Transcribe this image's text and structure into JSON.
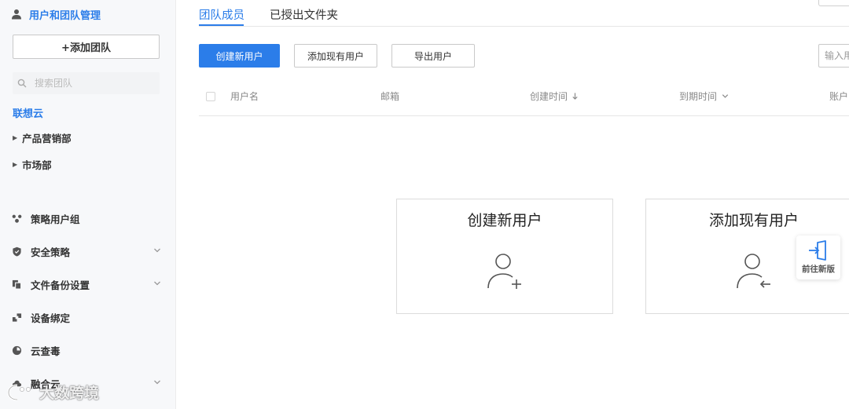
{
  "sidebar": {
    "title": "用户和团队管理",
    "add_team_label": "+添加团队",
    "search_placeholder": "搜索团队",
    "org_name": "联想云",
    "tree": [
      {
        "label": "产品营销部"
      },
      {
        "label": "市场部"
      }
    ],
    "nav": [
      {
        "label": "策略用户组",
        "icon": "group-icon",
        "expandable": false
      },
      {
        "label": "安全策略",
        "icon": "shield-icon",
        "expandable": true
      },
      {
        "label": "文件备份设置",
        "icon": "copy-icon",
        "expandable": true
      },
      {
        "label": "设备绑定",
        "icon": "link-icon",
        "expandable": false
      },
      {
        "label": "云查毒",
        "icon": "pie-icon",
        "expandable": false
      },
      {
        "label": "融合云",
        "icon": "cloud-icon",
        "expandable": true
      }
    ]
  },
  "watermark": "大数跨境",
  "tabs": [
    {
      "label": "团队成员",
      "active": true
    },
    {
      "label": "已授出文件夹",
      "active": false
    }
  ],
  "toolbar": {
    "create_label": "创建新用户",
    "add_existing_label": "添加现有用户",
    "export_label": "导出用户",
    "search_placeholder": "输入用户名"
  },
  "table": {
    "columns": [
      {
        "label": "用户名"
      },
      {
        "label": "邮箱"
      },
      {
        "label": "创建时间",
        "sort": "desc"
      },
      {
        "label": "到期时间",
        "sort": "dropdown"
      },
      {
        "label": "账户"
      }
    ],
    "rows": []
  },
  "cards": {
    "create_title": "创建新用户",
    "add_title": "添加现有用户"
  },
  "float_button": {
    "label": "前往新版"
  },
  "colors": {
    "accent": "#2b7de9",
    "sidebar_bg": "#f7f8fa"
  }
}
